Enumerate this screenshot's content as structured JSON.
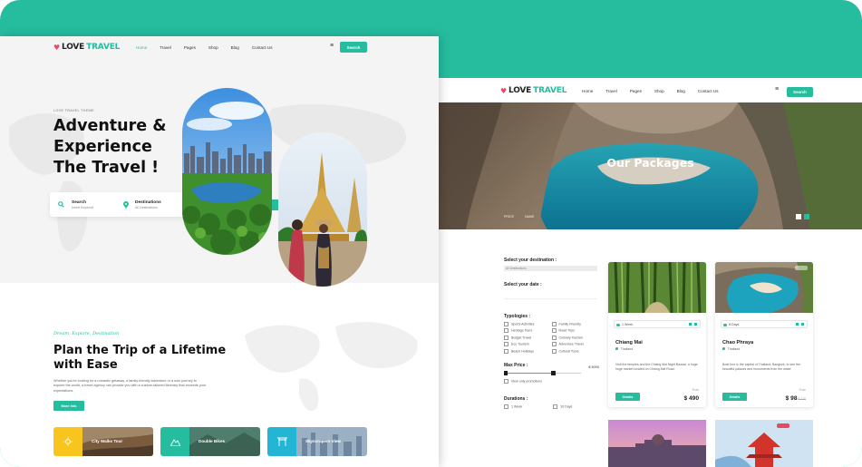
{
  "brand": {
    "accent": "#26bc9e",
    "highlight": "#f7c51d"
  },
  "nav": {
    "logo_love": "LOVE",
    "logo_travel": "TRAVEL",
    "links": [
      "Home",
      "Travel",
      "Pages",
      "Shop",
      "Blog",
      "Contact Us"
    ],
    "search_label": "Search"
  },
  "front": {
    "kicker": "LOVE TRAVEL THEME",
    "title_1": "Adventure &",
    "title_2": "Experience",
    "title_3": "The Travel !",
    "search": {
      "label": "Search",
      "placeholder": "Insert Keyword",
      "dest_label": "Destinations",
      "dest_value": "All Destinations"
    },
    "script": "Dream, Explore, Destination",
    "section_title_1": "Plan the Trip of a Lifetime",
    "section_title_2": "with Ease",
    "section_text": "Whether you're looking for a romantic getaway, a family-friendly adventure or a solo journey to explore the world, a travel agency can provide you with a custom-tailored itinerary that exceeds your expectations.",
    "more_label": "More Info",
    "tiles": [
      {
        "label": "City Walks Tour",
        "color": "#f7c51d",
        "icon": "sun-icon"
      },
      {
        "label": "Double Bikes",
        "color": "#26bc9e",
        "icon": "mountain-icon"
      },
      {
        "label": "Skyscrapers View",
        "color": "#22b5d4",
        "icon": "gate-icon"
      }
    ]
  },
  "back": {
    "hero_title": "Our Packages",
    "sort_1": "PRICE",
    "sort_2": "NAME",
    "filters": {
      "destination_label": "Select your destination :",
      "destination_value": "All Destinations",
      "date_label": "Select your date :",
      "typologies_label": "Typologies :",
      "typologies": [
        "Sports Activities",
        "Family Friendly",
        "Heritage Tours",
        "Road Trips",
        "Budget Travel",
        "Culinary Tourism",
        "Eco Tourism",
        "Adventure Travel",
        "Beach Holidays",
        "Cultural Tours"
      ],
      "max_price_label": "Max Price :",
      "max_price_value": "$ 5000",
      "promo_label": "View only promotions",
      "durations_label": "Durations :",
      "durations": [
        "1 Week",
        "10 Days"
      ]
    },
    "cards": [
      {
        "duration": "1 Week",
        "name": "Chiang Mai",
        "place": "Thailand",
        "desc": "Visit the temples and the Chiang Mai Night Bazaar, a huge huge market located on Chiang Mai Road.",
        "details": "Details",
        "from": "From",
        "price": "$ 490",
        "old_price": ""
      },
      {
        "duration": "8 Days",
        "name": "Chao Phraya",
        "place": "Thailand",
        "desc": "Boat tour in the capital of Thailand, Bangkok, to see the beautiful palaces and monuments from the water.",
        "details": "Details",
        "from": "From",
        "price": "$ 98",
        "old_price": "$ 120"
      }
    ]
  }
}
